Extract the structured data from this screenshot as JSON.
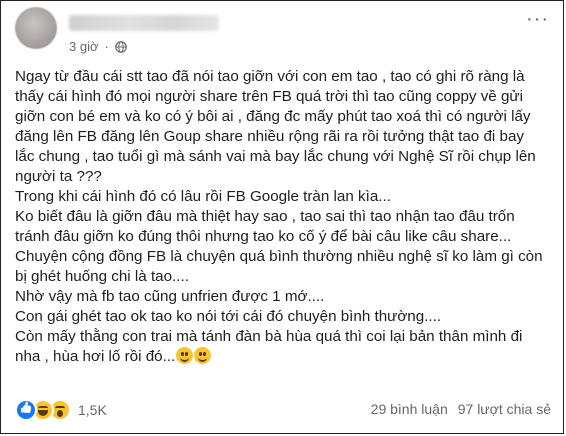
{
  "post": {
    "author_name": "",
    "time": "3 giờ",
    "privacy_icon": "globe-icon",
    "more_icon": "more-options-icon",
    "lines": [
      "Ngay từ đầu cái stt tao đã nói tao giỡn với con em tao , tao có ghi rõ ràng là",
      "thấy cái hình đó mọi người share trên FB quá trời thì tao cũng coppy về gửi",
      "giỡn con bé em và ko có ý bôi ai , đăng đc mấy phút tao xoá thì có người lấy",
      "đăng lên FB đăng lên Goup share nhiều rộng rãi ra rồi tưởng thật tao đi bay",
      "lắc chung , tao tuổi gì mà sánh vai mà bay lắc chung với Nghệ Sĩ rồi chụp lên",
      "người ta ???",
      "Trong khi cái hình đó có lâu rồi FB Google tràn lan kìa...",
      "Ko biết đâu là giỡn đâu mà thiệt hay sao , tao sai thì tao nhận tao đâu trốn",
      "tránh đâu giỡn ko đúng thôi nhưng tao ko cố ý để bài câu like câu share...",
      "Chuyện cộng đồng FB là chuyện quá bình thường nhiều nghệ sĩ ko làm gì còn",
      "bị ghét huống chi là tao....",
      "Nhờ vậy mà fb tao cũng unfrien được 1 mớ....",
      "Con gái ghét tao ok tao ko nói tới cái đó chuyện bình thường....",
      "Còn mấy thằng con trai mà tánh đàn bà hùa quá thì coi lại bản thân mình đi",
      "nha , hùa hơi lố rồi đó..."
    ],
    "last_line_emojis": [
      "smiley-emoji-icon",
      "smiley-emoji-icon"
    ]
  },
  "footer": {
    "reaction_icons": [
      "like-icon",
      "haha-icon",
      "wow-icon"
    ],
    "reaction_count": "1,5K",
    "comments": "29 bình luận",
    "shares": "97 lượt chia sẻ"
  },
  "colors": {
    "text": "#1c1e21",
    "secondary": "#65676b",
    "like_blue": "#1877f2",
    "emoji_yellow": "#f7c530"
  }
}
